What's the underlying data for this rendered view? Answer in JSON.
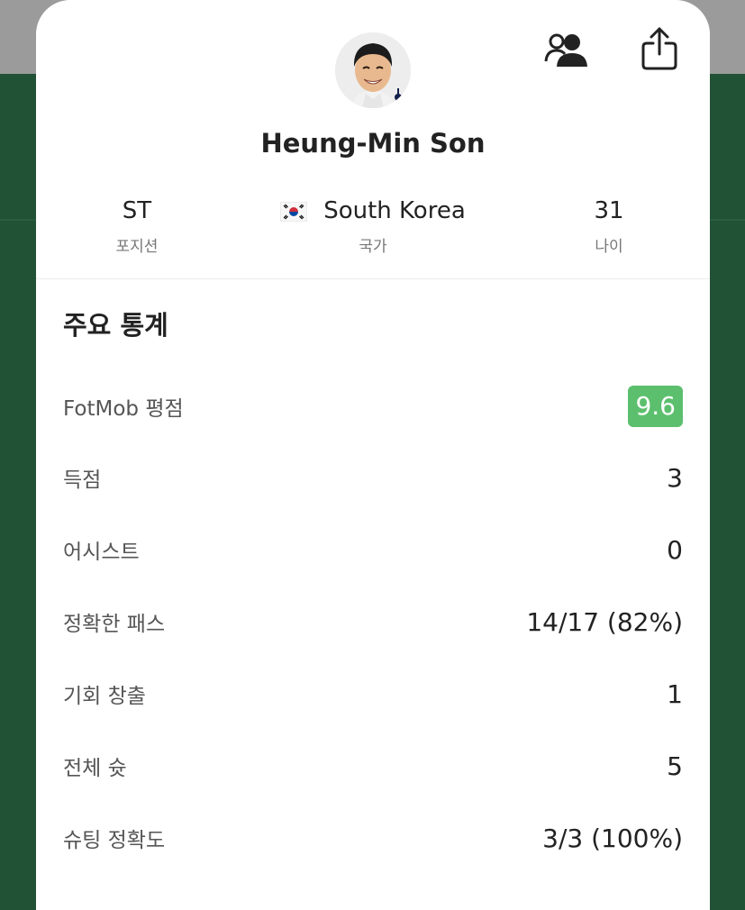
{
  "player": {
    "name": "Heung-Min Son"
  },
  "info": {
    "position": {
      "value": "ST",
      "label": "포지션"
    },
    "country": {
      "value": "South Korea",
      "label": "국가",
      "flag_icon": "south-korea-flag-icon"
    },
    "age": {
      "value": "31",
      "label": "나이"
    }
  },
  "header_icons": {
    "follow": "person-group-icon",
    "share": "share-icon"
  },
  "stats": {
    "title": "주요 통계",
    "rows": [
      {
        "label": "FotMob 평점",
        "value": "9.6"
      },
      {
        "label": "득점",
        "value": "3"
      },
      {
        "label": "어시스트",
        "value": "0"
      },
      {
        "label": "정확한 패스",
        "value": "14/17 (82%)"
      },
      {
        "label": "기회 창출",
        "value": "1"
      },
      {
        "label": "전체 슛",
        "value": "5"
      },
      {
        "label": "슈팅 정확도",
        "value": "3/3 (100%)"
      }
    ]
  },
  "colors": {
    "rating_badge": "#5cbf6e",
    "backdrop_green": "#215236"
  }
}
